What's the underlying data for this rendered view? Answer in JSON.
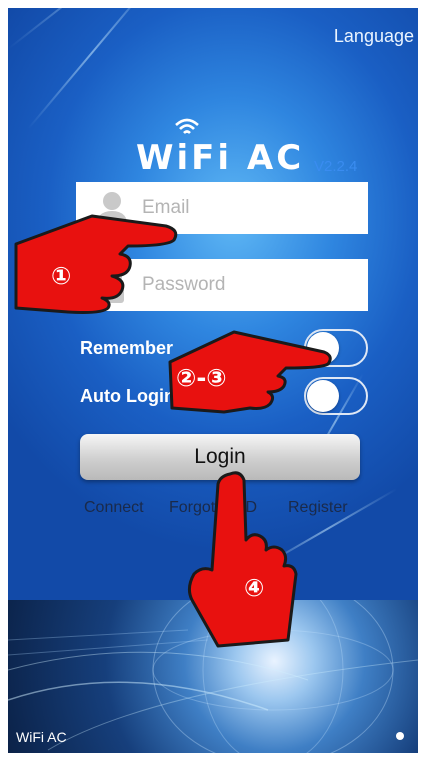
{
  "header": {
    "language_label": "Language"
  },
  "brand": {
    "logo_text": "WiFi AC",
    "version": "V2.2.4"
  },
  "form": {
    "email_placeholder": "Email",
    "password_placeholder": "Password",
    "remember_label": "Remember",
    "auto_login_label": "Auto Login",
    "remember_on": false,
    "auto_login_on": false
  },
  "actions": {
    "login_label": "Login",
    "connect_label": "Connect",
    "forgot_label": "Forgot PWD",
    "register_label": "Register"
  },
  "banner": {
    "title": "WiFi AC"
  },
  "annotations": {
    "step1": "①",
    "step2_3": "②-③",
    "step4": "④",
    "hand_color": "#e8110f"
  }
}
